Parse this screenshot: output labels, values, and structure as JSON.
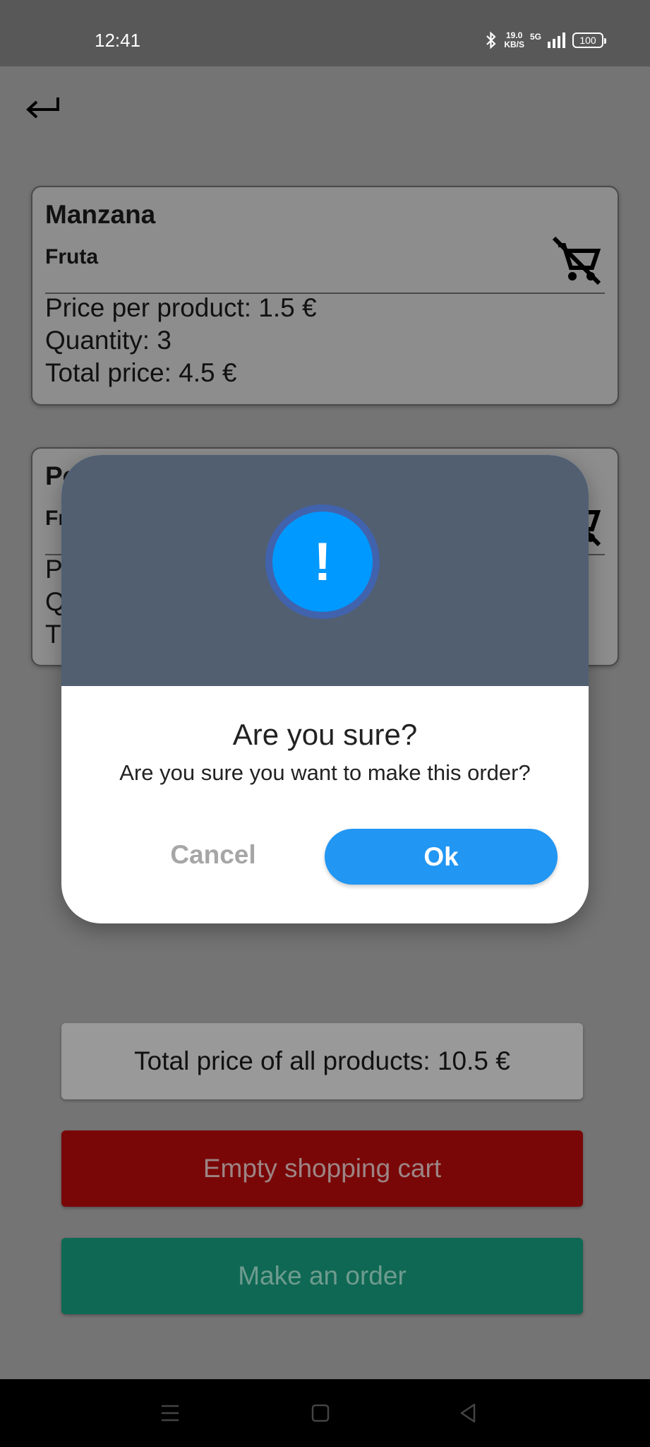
{
  "status_bar": {
    "time": "12:41",
    "speed_value": "19.0",
    "speed_unit": "KB/S",
    "network": "5G",
    "battery": "100"
  },
  "nav": {
    "back_icon": "return-arrow-icon"
  },
  "cart_items": [
    {
      "name": "Manzana",
      "category": "Fruta",
      "price_line": "Price per product: 1.5 €",
      "quantity_line": "Quantity: 3",
      "total_line": "Total price: 4.5 €",
      "icon": "remove-shopping-cart-icon"
    },
    {
      "name": "Pe",
      "category": "Fr",
      "price_line": "P",
      "quantity_line": "Q",
      "total_line": "T",
      "icon": "remove-shopping-cart-icon"
    }
  ],
  "summary": {
    "total_label": "Total price of all products: 10.5 €",
    "empty_cart_label": "Empty shopping cart",
    "make_order_label": "Make an order"
  },
  "dialog": {
    "icon": "exclamation-alert-icon",
    "icon_glyph": "!",
    "title": "Are you sure?",
    "message": "Are you sure you want to make this order?",
    "cancel_label": "Cancel",
    "ok_label": "Ok"
  },
  "colors": {
    "ok_button": "#2196f3",
    "empty_button": "#7a0707",
    "order_button": "#0f6854",
    "dialog_header": "#515f71",
    "alert_icon": "#0099ff"
  }
}
